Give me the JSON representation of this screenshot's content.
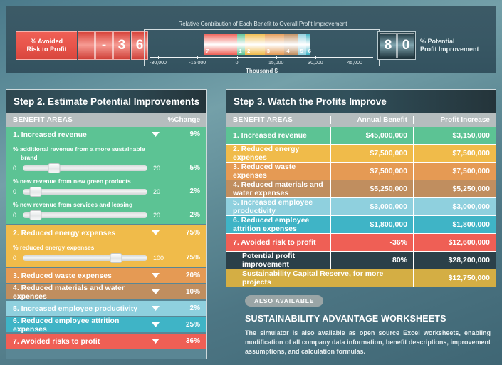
{
  "topbar": {
    "left_gauge": {
      "label_line1": "% Avoided",
      "label_line2": "Risk to Profit",
      "digits": [
        "",
        "-",
        "3",
        "6"
      ],
      "value": "-36",
      "color": "#e8554b"
    },
    "right_gauge": {
      "label_line1": "% Potential",
      "label_line2": "Profit Improvement",
      "digits": [
        "8",
        "0"
      ],
      "value": "80",
      "color": "#2b454e"
    }
  },
  "chart_data": {
    "type": "bar",
    "orientation": "horizontal-stacked",
    "title": "Relative Contribution of Each Benefit to Overall Profit Improvement",
    "xlabel": "Thousand $",
    "ylabel": "",
    "xlim": [
      -33000,
      52000
    ],
    "tick_labels": [
      "-30,000",
      "-15,000",
      "0",
      "15,000",
      "30,000",
      "45,000"
    ],
    "tick_values": [
      -30000,
      -15000,
      0,
      15000,
      30000,
      45000
    ],
    "grid": false,
    "legend": "none",
    "categories": [
      "7",
      "1",
      "2",
      "3",
      "4",
      "5",
      "6"
    ],
    "series": [
      {
        "name": "Contribution",
        "points": [
          {
            "label": "7",
            "name": "Avoided risk to profit",
            "value": -12600,
            "color": "#ef5f55"
          },
          {
            "label": "1",
            "name": "Increased revenue",
            "value": 3150,
            "color": "#5cc394"
          },
          {
            "label": "2",
            "name": "Reduced energy expenses",
            "value": 7500,
            "color": "#f0bb4a"
          },
          {
            "label": "3",
            "name": "Reduced waste expenses",
            "value": 7500,
            "color": "#e59a54"
          },
          {
            "label": "4",
            "name": "Reduced materials and water expenses",
            "value": 5250,
            "color": "#c08e5f"
          },
          {
            "label": "5",
            "name": "Increased employee productivity",
            "value": 3000,
            "color": "#8fd0de"
          },
          {
            "label": "6",
            "name": "Reduced employee attrition expenses",
            "value": 1800,
            "color": "#3fb4c6"
          }
        ]
      }
    ]
  },
  "step2": {
    "title": "Step 2. Estimate Potential Improvements",
    "col_benefit": "BENEFIT AREAS",
    "col_change": "%Change",
    "caret_icon": "chevron-down-icon",
    "benefits": [
      {
        "name": "1. Increased revenue",
        "pct": "9%",
        "color": "#5cc394",
        "expanded": true,
        "sliders": [
          {
            "label": "% additional revenue from a more sustainable",
            "label2": "brand",
            "min": "0",
            "max": "20",
            "value": "5%",
            "pos": 25
          },
          {
            "label": "% new revenue from new green products",
            "min": "0",
            "max": "20",
            "value": "2%",
            "pos": 10
          },
          {
            "label": "% new revenue from services and leasing",
            "min": "0",
            "max": "20",
            "value": "2%",
            "pos": 10
          }
        ]
      },
      {
        "name": "2. Reduced energy expenses",
        "pct": "75%",
        "color": "#f0bb4a",
        "expanded": true,
        "sliders": [
          {
            "label": "% reduced energy expenses",
            "min": "0",
            "max": "100",
            "value": "75%",
            "pos": 75
          }
        ]
      },
      {
        "name": "3. Reduced waste expenses",
        "pct": "20%",
        "color": "#e59a54",
        "expanded": false,
        "sliders": []
      },
      {
        "name": "4. Reduced materials and water expenses",
        "pct": "10%",
        "color": "#c08e5f",
        "expanded": false,
        "sliders": []
      },
      {
        "name": "5. Increased employee productivity",
        "pct": "2%",
        "color": "#8fd0de",
        "expanded": false,
        "sliders": []
      },
      {
        "name": "6. Reduced employee attrition expenses",
        "pct": "25%",
        "color": "#3fb4c6",
        "expanded": false,
        "sliders": []
      },
      {
        "name": "7. Avoided risks to profit",
        "pct": "36%",
        "color": "#ef5f55",
        "expanded": false,
        "sliders": []
      }
    ]
  },
  "step3": {
    "title": "Step 3. Watch the Profits Improve",
    "columns": [
      "BENEFIT AREAS",
      "Annual Benefit",
      "Profit Increase"
    ],
    "rows": [
      {
        "name": "1. Increased revenue",
        "annual": "$45,000,000",
        "profit": "$3,150,000",
        "color": "#5cc394"
      },
      {
        "name": "2. Reduced energy expenses",
        "annual": "$7,500,000",
        "profit": "$7,500,000",
        "color": "#f0bb4a"
      },
      {
        "name": "3. Reduced waste expenses",
        "annual": "$7,500,000",
        "profit": "$7,500,000",
        "color": "#e59a54"
      },
      {
        "name": "4. Reduced materials and water expenses",
        "annual": "$5,250,000",
        "profit": "$5,250,000",
        "color": "#c08e5f"
      },
      {
        "name": "5. Increased employee productivity",
        "annual": "$3,000,000",
        "profit": "$3,000,000",
        "color": "#8fd0de"
      },
      {
        "name": "6. Reduced employee attrition expenses",
        "annual": "$1,800,000",
        "profit": "$1,800,000",
        "color": "#3fb4c6"
      },
      {
        "name": "7. Avoided risk to profit",
        "annual": "-36%",
        "profit": "$12,600,000",
        "color": "#ef5f55"
      },
      {
        "name": "Potential profit improvement",
        "annual": "80%",
        "profit": "$28,200,000",
        "color": "#2b4049",
        "indent": true
      },
      {
        "name": "Sustainability Capital Reserve, for more projects",
        "annual": "",
        "profit": "$12,750,000",
        "color": "#d4ae44",
        "indent": true,
        "merged": true
      }
    ]
  },
  "also_available": {
    "pill": "ALSO AVAILABLE",
    "title": "SUSTAINABILITY ADVANTAGE WORKSHEETS",
    "body": "The simulator is also available as open source Excel worksheets, enabling modification of all company data information, benefit descriptions, improvement assumptions, and calculation formulas."
  }
}
